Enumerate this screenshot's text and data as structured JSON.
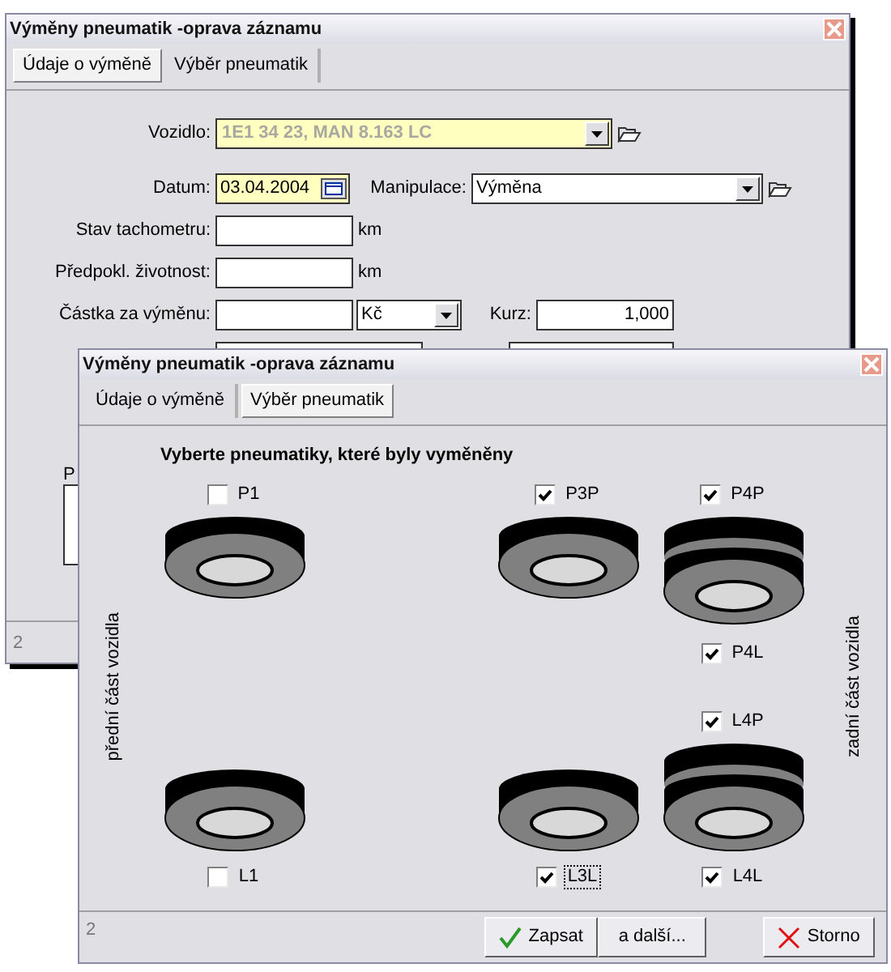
{
  "back_window": {
    "title": "Výměny pneumatik -oprava záznamu",
    "tabs": [
      {
        "label": "Údaje o výměně",
        "selected": true
      },
      {
        "label": "Výběr pneumatik",
        "selected": false
      }
    ],
    "form": {
      "vehicle": {
        "label": "Vozidlo:",
        "value": "1E1 34 23, MAN 8.163 LC",
        "disabled": true
      },
      "date": {
        "label": "Datum:",
        "value": "03.04.2004"
      },
      "operation": {
        "label": "Manipulace:",
        "value": "Výměna"
      },
      "odometer": {
        "label": "Stav tachometru:",
        "unit": "km"
      },
      "lifetime": {
        "label": "Předpokl. životnost:",
        "unit": "km"
      },
      "amount": {
        "label": "Částka za výměnu:",
        "currency": "Kč"
      },
      "rate": {
        "label": "Kurz:",
        "value": "1,000"
      }
    },
    "note_label": "P",
    "status": "2"
  },
  "front_window": {
    "title": "Výměny pneumatik -oprava záznamu",
    "tabs": [
      {
        "label": "Údaje o výměně",
        "selected": false
      },
      {
        "label": "Výběr pneumatik",
        "selected": true
      }
    ],
    "heading": "Vyberte pneumatiky, které byly vyměněny",
    "front_label": "přední část vozidla",
    "rear_label": "zadní část vozidla",
    "axles": [
      {
        "kind": "single",
        "top": [
          {
            "label": "P1",
            "checked": false,
            "focused": false
          }
        ],
        "bottom": [
          {
            "label": "L1",
            "checked": false,
            "focused": false
          }
        ]
      },
      {
        "kind": "single",
        "top": [
          {
            "label": "P3P",
            "checked": true,
            "focused": false
          }
        ],
        "bottom": [
          {
            "label": "L3L",
            "checked": true,
            "focused": true
          }
        ]
      },
      {
        "kind": "dual",
        "top": [
          {
            "label": "P4P",
            "checked": true,
            "focused": false
          },
          {
            "label": "P4L",
            "checked": true,
            "focused": false
          }
        ],
        "bottom": [
          {
            "label": "L4P",
            "checked": true,
            "focused": false
          },
          {
            "label": "L4L",
            "checked": true,
            "focused": false
          }
        ]
      }
    ],
    "status": "2",
    "buttons": [
      {
        "label": "Zapsat",
        "kind": "confirm"
      },
      {
        "label": "a další...",
        "kind": "plain"
      },
      {
        "label": "Storno",
        "kind": "cancel"
      }
    ]
  }
}
